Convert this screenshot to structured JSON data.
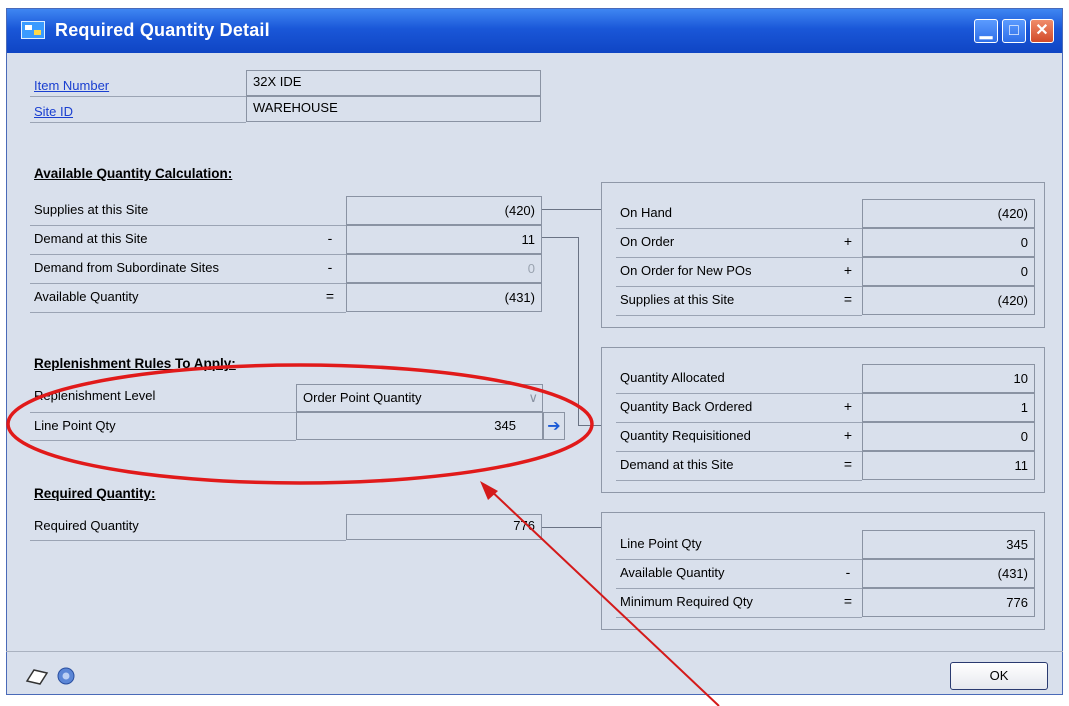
{
  "window": {
    "title": "Required Quantity Detail"
  },
  "header": {
    "item_number_label": "Item Number",
    "item_number_value": "32X IDE",
    "site_id_label": "Site ID",
    "site_id_value": "WAREHOUSE"
  },
  "available_calc": {
    "heading": "Available Quantity Calculation:",
    "rows": [
      {
        "label": "Supplies at this Site",
        "op": "",
        "value": "(420)"
      },
      {
        "label": "Demand at this Site",
        "op": "-",
        "value": "11"
      },
      {
        "label": "Demand from Subordinate Sites",
        "op": "-",
        "value": "0"
      },
      {
        "label": "Available Quantity",
        "op": "=",
        "value": "(431)"
      }
    ]
  },
  "replenishment": {
    "heading": "Replenishment Rules To Apply:",
    "level_label": "Replenishment Level",
    "level_value": "Order Point Quantity",
    "line_point_label": "Line Point Qty",
    "line_point_value": "345"
  },
  "required": {
    "heading": "Required Quantity:",
    "label": "Required Quantity",
    "value": "776"
  },
  "supplies_panel": [
    {
      "label": "On Hand",
      "op": "",
      "value": "(420)"
    },
    {
      "label": "On Order",
      "op": "+",
      "value": "0"
    },
    {
      "label": "On Order for New POs",
      "op": "+",
      "value": "0"
    },
    {
      "label": "Supplies at this Site",
      "op": "=",
      "value": "(420)"
    }
  ],
  "demand_panel": [
    {
      "label": "Quantity Allocated",
      "op": "",
      "value": "10"
    },
    {
      "label": "Quantity Back Ordered",
      "op": "+",
      "value": "1"
    },
    {
      "label": "Quantity Requisitioned",
      "op": "+",
      "value": "0"
    },
    {
      "label": "Demand at this Site",
      "op": "=",
      "value": "11"
    }
  ],
  "required_panel": [
    {
      "label": "Line Point Qty",
      "op": "",
      "value": "345"
    },
    {
      "label": "Available Quantity",
      "op": "-",
      "value": "(431)"
    },
    {
      "label": "Minimum Required Qty",
      "op": "=",
      "value": "776"
    }
  ],
  "footer": {
    "ok_label": "OK"
  },
  "icons": {
    "app": "window-app-icon",
    "note": "note-icon",
    "help": "help-icon",
    "arrow": "blue-arrow-icon"
  },
  "colors": {
    "titlebar": "#1a57d8",
    "link": "#1a3fd0",
    "annotation": "#e11a1a",
    "arrow_line": "#d41a1a"
  }
}
